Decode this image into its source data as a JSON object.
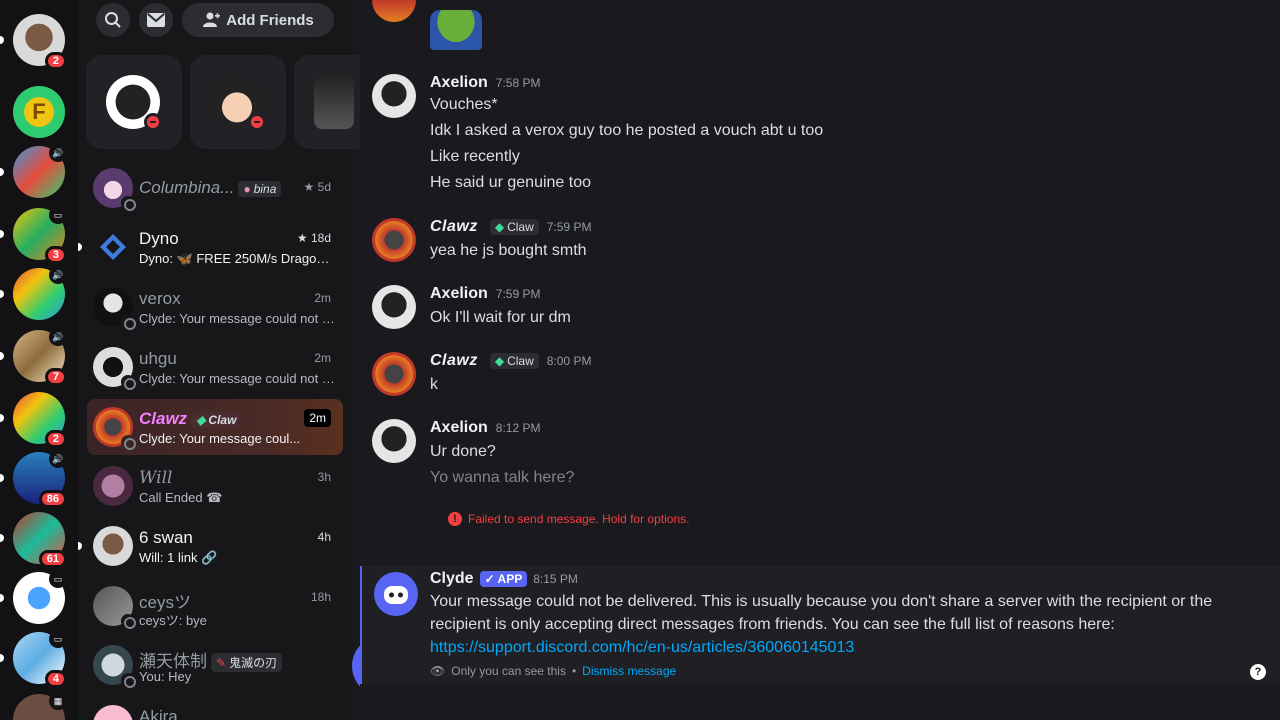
{
  "rail": {
    "servers": [
      {
        "badge": "2"
      },
      {
        "badge": ""
      },
      {
        "badge": ""
      },
      {
        "badge": "3"
      },
      {
        "badge": ""
      },
      {
        "badge": "7"
      },
      {
        "badge": "2"
      },
      {
        "badge": "86"
      },
      {
        "badge": "61"
      },
      {
        "badge": ""
      },
      {
        "badge": "4"
      }
    ]
  },
  "sidebar": {
    "add_friends_label": "Add Friends",
    "dms": [
      {
        "name": "Columbina...",
        "tag": "bina",
        "time": "5d",
        "preview": ""
      },
      {
        "name": "Dyno",
        "time": "18d",
        "preview": "Dyno: 🦋 FREE 250M/s Dragon C..."
      },
      {
        "name": "verox",
        "time": "2m",
        "preview": "Clyde: Your message could not b..."
      },
      {
        "name": "uhgu",
        "time": "2m",
        "preview": "Clyde: Your message could not b..."
      },
      {
        "name": "Clawz",
        "tag": "Claw",
        "time": "2m",
        "preview": "Clyde: Your message coul..."
      },
      {
        "name": "Will",
        "time": "3h",
        "preview": "Call Ended"
      },
      {
        "name": "6 swan",
        "time": "4h",
        "preview": "Will: 1 link"
      },
      {
        "name": "ceysツ",
        "time": "18h",
        "preview": "ceysツ: bye"
      },
      {
        "name": "瀬天体制",
        "tag": "鬼滅の刃",
        "time": "",
        "preview": "You: Hey"
      },
      {
        "name": "Akira",
        "time": "",
        "preview": ""
      }
    ]
  },
  "chat": {
    "messages": [
      {
        "author": "Axelion",
        "time": "7:58 PM",
        "lines": [
          "Vouches*",
          "Idk I asked a verox guy too he posted a vouch abt u too",
          "Like recently",
          "He said ur genuine too"
        ]
      },
      {
        "author": "Clawz",
        "tag": "Claw",
        "time": "7:59 PM",
        "lines": [
          "yea he js bought smth"
        ]
      },
      {
        "author": "Axelion",
        "time": "7:59 PM",
        "lines": [
          "Ok I'll wait for ur dm"
        ]
      },
      {
        "author": "Clawz",
        "tag": "Claw",
        "time": "8:00 PM",
        "lines": [
          "k"
        ]
      },
      {
        "author": "Axelion",
        "time": "8:12 PM",
        "lines": [
          "Ur done?",
          "Yo wanna talk here?"
        ]
      }
    ],
    "failed_notice": "Failed to send message. Hold for options.",
    "clyde": {
      "author": "Clyde",
      "app_tag": "✓ APP",
      "time": "8:15 PM",
      "body": "Your message could not be delivered. This is usually because you don't share a server with the recipient or the recipient is only accepting direct messages from friends. You can see the full list of reasons here: ",
      "link": "https://support.discord.com/hc/en-us/articles/360060145013",
      "ephemeral_note": "Only you can see this",
      "dismiss_label": "Dismiss message"
    }
  },
  "colors": {
    "accent": "#5865f2",
    "danger": "#f23f43",
    "link": "#00a8fc"
  }
}
